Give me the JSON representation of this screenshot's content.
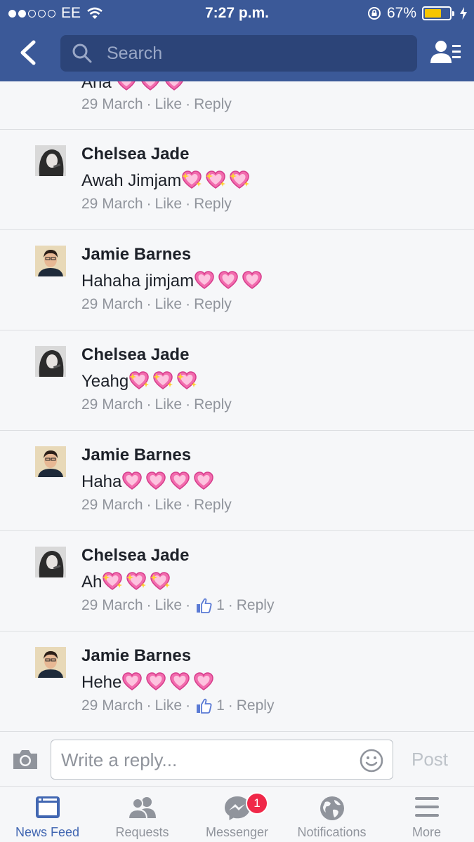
{
  "status_bar": {
    "carrier": "EE",
    "time": "7:27 p.m.",
    "battery": "67%",
    "battery_level": 0.67
  },
  "header": {
    "search_placeholder": "Search"
  },
  "partial_comment": {
    "text": "Aha",
    "date": "29 March",
    "like": "Like",
    "reply": "Reply"
  },
  "comments": [
    {
      "author": "Chelsea Jade",
      "text": "Awah Jimjam",
      "emoji": "sparkling-heart",
      "emoji_count": 3,
      "date": "29 March",
      "like": "Like",
      "reply": "Reply"
    },
    {
      "author": "Jamie Barnes",
      "text": "Hahaha jimjam",
      "emoji": "pink-heart",
      "emoji_count": 3,
      "date": "29 March",
      "like": "Like",
      "reply": "Reply"
    },
    {
      "author": "Chelsea Jade",
      "text": "Yeahg",
      "emoji": "sparkling-heart",
      "emoji_count": 3,
      "date": "29 March",
      "like": "Like",
      "reply": "Reply"
    },
    {
      "author": "Jamie Barnes",
      "text": "Haha",
      "emoji": "pink-heart",
      "emoji_count": 4,
      "date": "29 March",
      "like": "Like",
      "reply": "Reply"
    },
    {
      "author": "Chelsea Jade",
      "text": "Ah",
      "emoji": "sparkling-heart",
      "emoji_count": 3,
      "date": "29 March",
      "like": "Like",
      "like_count": "1",
      "reply": "Reply"
    },
    {
      "author": "Jamie Barnes",
      "text": "Hehe",
      "emoji": "pink-heart",
      "emoji_count": 4,
      "date": "29 March",
      "like": "Like",
      "like_count": "1",
      "reply": "Reply"
    }
  ],
  "composer": {
    "placeholder": "Write a reply...",
    "post_label": "Post"
  },
  "tabs": [
    {
      "label": "News Feed",
      "icon": "news-feed-icon",
      "active": true
    },
    {
      "label": "Requests",
      "icon": "friend-requests-icon"
    },
    {
      "label": "Messenger",
      "icon": "messenger-icon",
      "badge": "1"
    },
    {
      "label": "Notifications",
      "icon": "globe-icon"
    },
    {
      "label": "More",
      "icon": "menu-icon"
    }
  ],
  "colors": {
    "brand": "#3b5998",
    "search_bg": "#2c4478",
    "active_tab": "#4267b2",
    "badge": "#f02849",
    "muted": "#90949c"
  }
}
